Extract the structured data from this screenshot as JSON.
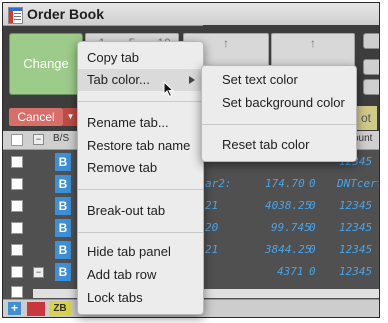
{
  "window": {
    "title": "Order Book"
  },
  "top_buttons": {
    "change_label": "Change",
    "up_arrow": "↑",
    "qty_glyphs": [
      "1",
      "5",
      "10"
    ]
  },
  "action_row": {
    "cancel_label": "Cancel",
    "partial_label": "ot"
  },
  "grid": {
    "headers": {
      "bs": "B/S",
      "account_partial": "count"
    },
    "rows": [
      {
        "side": "B",
        "col1": "",
        "col2": "",
        "col3": "",
        "col4": "12345"
      },
      {
        "side": "B",
        "col1": "ar2:",
        "col2": "174.70",
        "col3": "0",
        "col4": "DNTcert"
      },
      {
        "side": "B",
        "col1": "21",
        "col2": "4038.25",
        "col3": "0",
        "col4": "12345"
      },
      {
        "side": "B",
        "col1": "20",
        "col2": "99.745",
        "col3": "0",
        "col4": "12345"
      },
      {
        "side": "B",
        "col1": "21",
        "col2": "3844.25",
        "col3": "0",
        "col4": "12345"
      },
      {
        "side": "B",
        "col1": "",
        "col2": "4371",
        "col3": "0",
        "col4": "12345"
      },
      {
        "side": "",
        "col1": "",
        "col2": "",
        "col3": "",
        "col4": ""
      }
    ]
  },
  "bottom_tabs": {
    "add_label": "+",
    "tab_zb": "ZB"
  },
  "context_menu": {
    "items": [
      "Copy tab",
      "Tab color...",
      "Rename tab...",
      "Restore tab name",
      "Remove tab",
      "Break-out tab",
      "Hide tab panel",
      "Add tab row",
      "Lock tabs"
    ]
  },
  "submenu": {
    "items": [
      "Set text color",
      "Set background color",
      "Reset tab color"
    ]
  },
  "colors": {
    "change_green": "#9dcb8a",
    "cancel_red": "#d96d6a",
    "buy_blue": "#3e8fd6",
    "cell_text_blue": "#4aa3e6",
    "tab_red": "#c8373c",
    "tab_yellow": "#d9d24a"
  }
}
